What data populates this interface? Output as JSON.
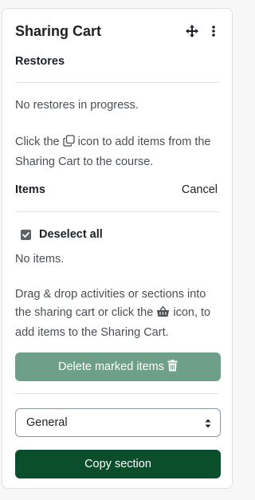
{
  "block": {
    "title": "Sharing Cart",
    "move_icon": "move-arrows-icon",
    "menu_icon": "kebab-menu-icon"
  },
  "restores": {
    "heading": "Restores",
    "status": "No restores in progress.",
    "help_before": "Click the",
    "help_icon": "copy-icon",
    "help_after": "icon to add items from the Sharing Cart to the course."
  },
  "items": {
    "heading": "Items",
    "cancel_label": "Cancel",
    "deselect_label": "Deselect all",
    "deselect_checked": true,
    "empty_text": "No items.",
    "help_before": "Drag & drop activities or sections into the sharing cart or click the",
    "help_icon": "basket-icon",
    "help_after": "icon, to add items to the Sharing Cart."
  },
  "actions": {
    "delete_label": "Delete marked items",
    "delete_icon": "trash-icon",
    "section_select_value": "General",
    "copy_label": "Copy section"
  },
  "colors": {
    "delete_button": "#6e9f88",
    "copy_button": "#0b4e2c"
  }
}
